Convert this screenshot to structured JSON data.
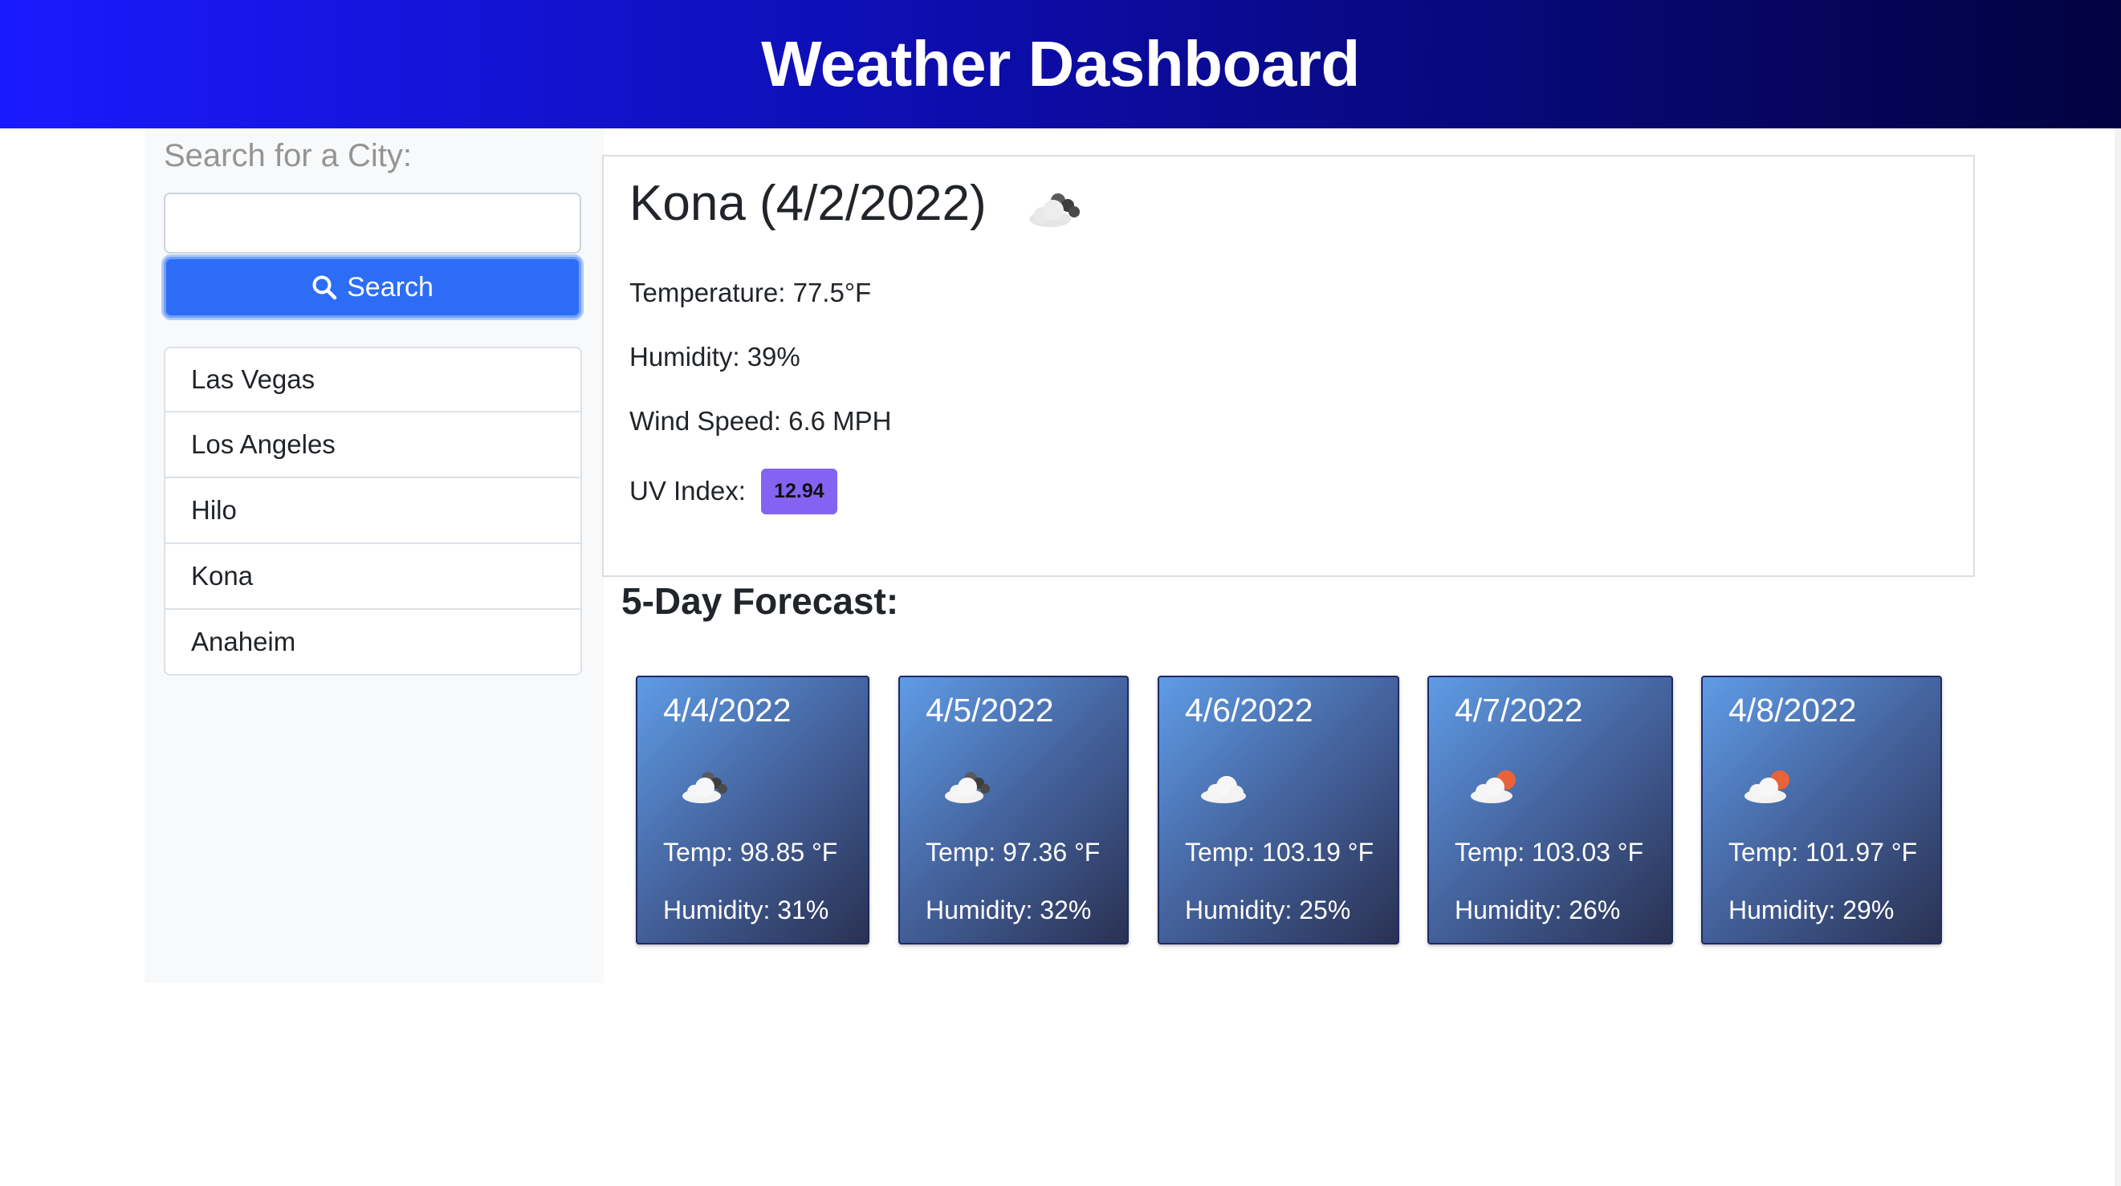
{
  "header": {
    "title": "Weather Dashboard"
  },
  "sidebar": {
    "search_label": "Search for a City:",
    "search_value": "",
    "search_placeholder": "",
    "search_button": "Search",
    "cities": [
      "Las Vegas",
      "Los Angeles",
      "Hilo",
      "Kona",
      "Anaheim"
    ]
  },
  "current": {
    "title": "Kona (4/2/2022)",
    "icon": "broken-clouds-icon",
    "temperature": "Temperature: 77.5°F",
    "humidity": "Humidity: 39%",
    "wind": "Wind Speed: 6.6 MPH",
    "uv_label": "UV Index:",
    "uv_value": "12.94",
    "uv_color": "#8463f2"
  },
  "forecast": {
    "title": "5-Day Forecast:",
    "days": [
      {
        "date": "4/4/2022",
        "icon": "broken-clouds-icon",
        "temp": "Temp: 98.85 °F",
        "humidity": "Humidity: 31%"
      },
      {
        "date": "4/5/2022",
        "icon": "broken-clouds-icon",
        "temp": "Temp: 97.36 °F",
        "humidity": "Humidity: 32%"
      },
      {
        "date": "4/6/2022",
        "icon": "cloud-icon",
        "temp": "Temp: 103.19 °F",
        "humidity": "Humidity: 25%"
      },
      {
        "date": "4/7/2022",
        "icon": "partly-cloudy-sun-icon",
        "temp": "Temp: 103.03 °F",
        "humidity": "Humidity: 26%"
      },
      {
        "date": "4/8/2022",
        "icon": "partly-cloudy-sun-icon",
        "temp": "Temp: 101.97 °F",
        "humidity": "Humidity: 29%"
      }
    ]
  },
  "colors": {
    "header_start": "#1a1aff",
    "header_end": "#020240",
    "search_button": "#2d6df6",
    "card_gradient_start": "#5f9ce6",
    "card_gradient_end": "#2a3152"
  }
}
